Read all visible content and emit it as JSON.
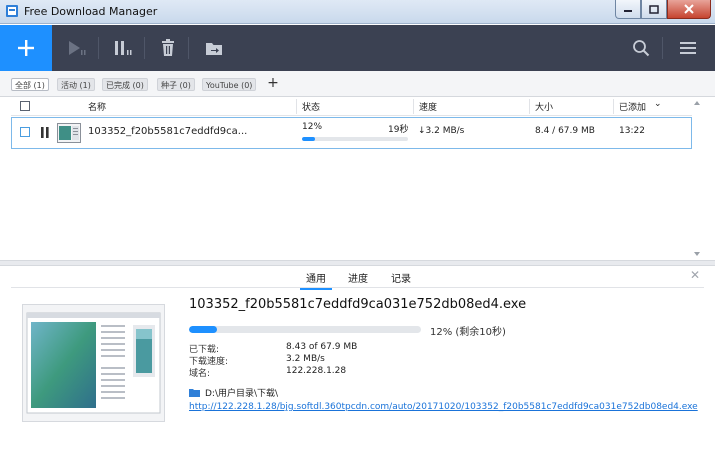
{
  "window": {
    "title": "Free Download Manager",
    "minimize_glyph": "─",
    "maximize_glyph": "□",
    "close_glyph": "✕"
  },
  "toolbar": {
    "add_glyph": "+",
    "icons": [
      "play-icon",
      "pause-icon",
      "delete-icon",
      "move-icon",
      "search-icon",
      "menu-icon"
    ],
    "accent_color": "#1e90ff",
    "bg_color": "#3b4152"
  },
  "filters": [
    {
      "label": "全部 (1)",
      "active": true
    },
    {
      "label": "活动 (1)",
      "active": false
    },
    {
      "label": "已完成 (0)",
      "active": false
    },
    {
      "label": "种子 (0)",
      "active": false
    },
    {
      "label": "YouTube (0)",
      "active": false
    }
  ],
  "filter_add_glyph": "+",
  "table": {
    "columns": {
      "name": "名称",
      "status": "状态",
      "speed": "速度",
      "size": "大小",
      "added": "已添加",
      "sort_glyph": "⌄"
    },
    "rows": [
      {
        "name": "103352_f20b5581c7eddfd9ca...",
        "status_percent": "12%",
        "remaining": "19秒",
        "progress": 0.12,
        "speed": "↓3.2 MB/s",
        "size": "8.4 / 67.9 MB",
        "added": "13:22"
      }
    ]
  },
  "details": {
    "tabs": [
      "通用",
      "进度",
      "记录"
    ],
    "active_tab": 0,
    "close_glyph": "✕",
    "filename": "103352_f20b5581c7eddfd9ca031e752db08ed4.exe",
    "progress": 0.12,
    "progress_text": "12% (剩余10秒)",
    "info": [
      {
        "label": "已下载:",
        "value": "8.43 of 67.9 MB"
      },
      {
        "label": "下载速度:",
        "value": "3.2 MB/s"
      },
      {
        "label": "域名:",
        "value": "122.228.1.28"
      }
    ],
    "folder": "D:\\用户目录\\下载\\",
    "url": "http://122.228.1.28/bjg.softdl.360tpcdn.com/auto/20171020/103352_f20b5581c7eddfd9ca031e752db08ed4.exe"
  }
}
